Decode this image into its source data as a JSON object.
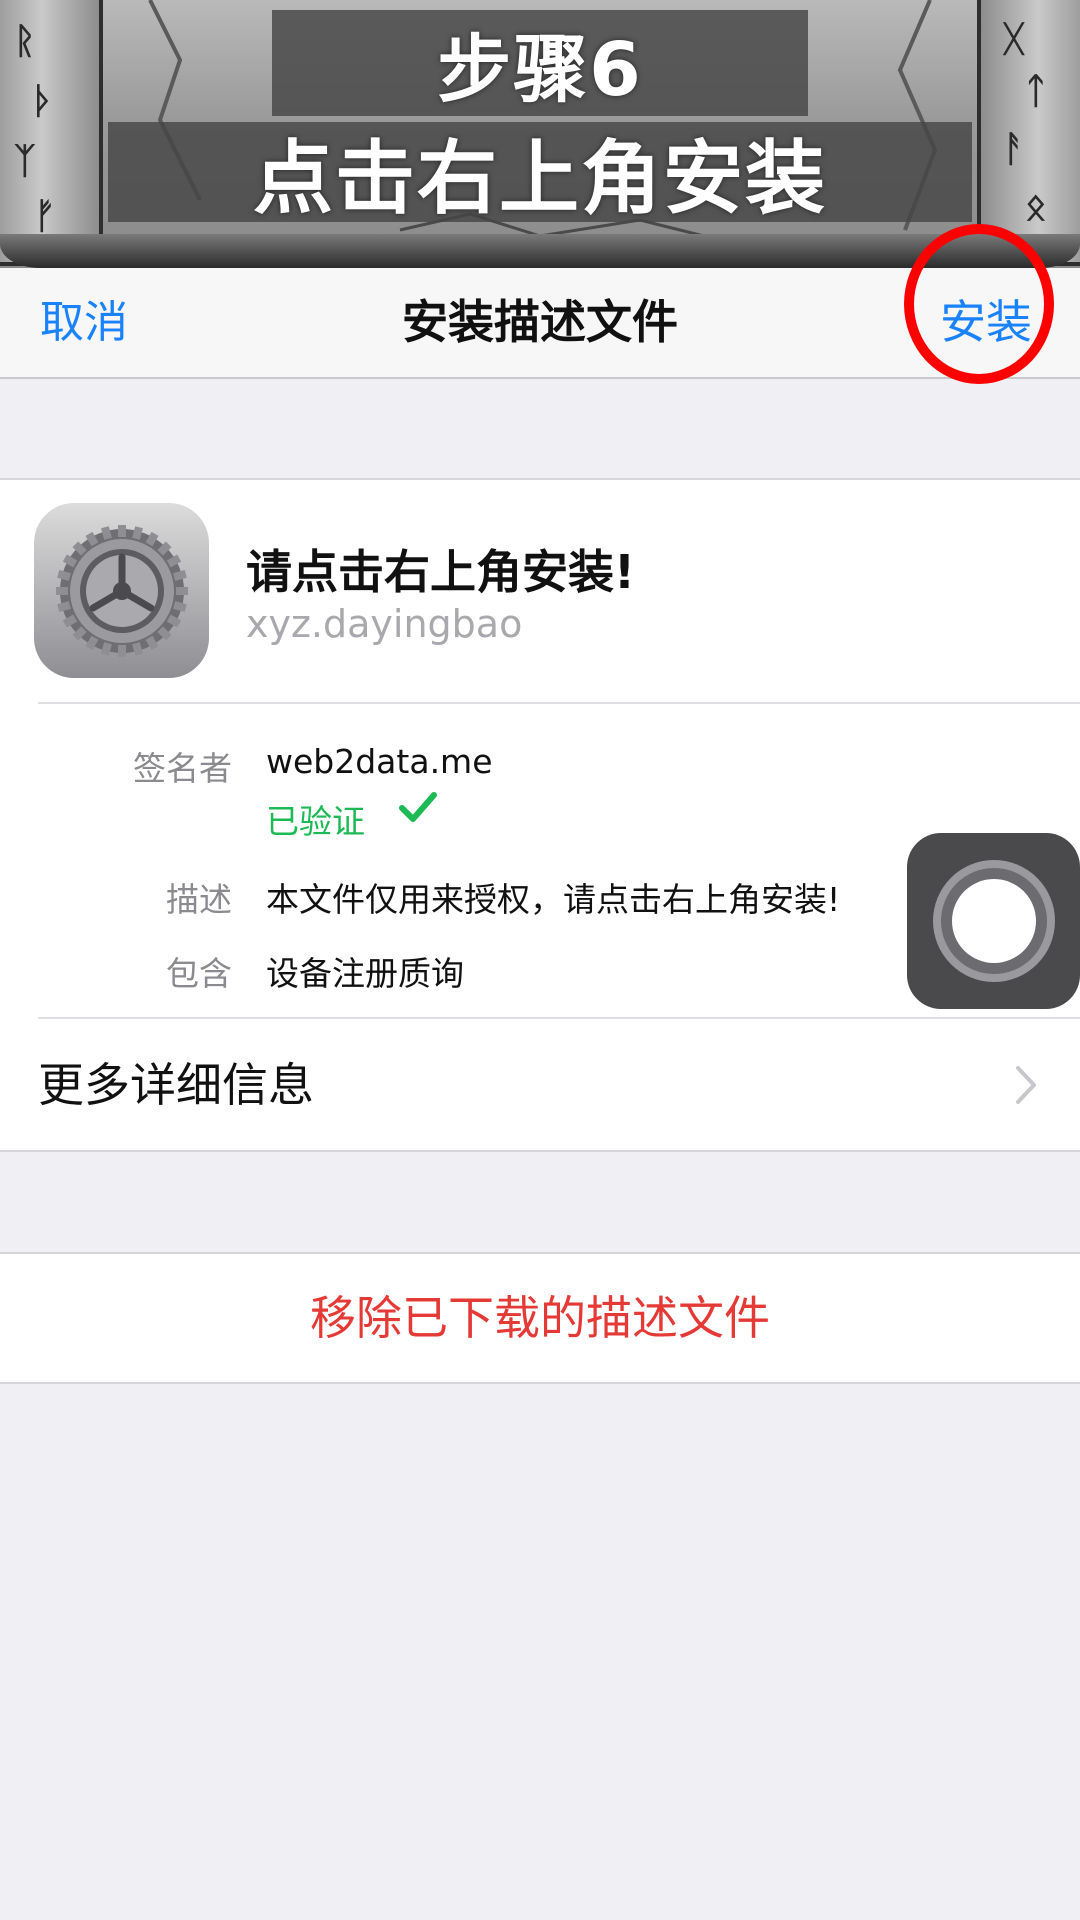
{
  "banner": {
    "step": "步骤6",
    "instruction": "点击右上角安装"
  },
  "navbar": {
    "cancel": "取消",
    "title": "安装描述文件",
    "install": "安装"
  },
  "profile": {
    "icon": "settings-gear-icon",
    "name": "请点击右上角安装!",
    "identifier": "xyz.dayingbao",
    "signer_label": "签名者",
    "signer_value": "web2data.me",
    "verified": "已验证",
    "verified_color": "#1db954",
    "description_label": "描述",
    "description_value": "本文件仅用来授权，请点击右上角安装!",
    "contains_label": "包含",
    "contains_value": "设备注册质询",
    "more_details": "更多详细信息"
  },
  "remove": {
    "label": "移除已下载的描述文件",
    "color": "#e53935"
  },
  "colors": {
    "accent": "#1a82fb",
    "highlight_ring": "#ff0000"
  }
}
